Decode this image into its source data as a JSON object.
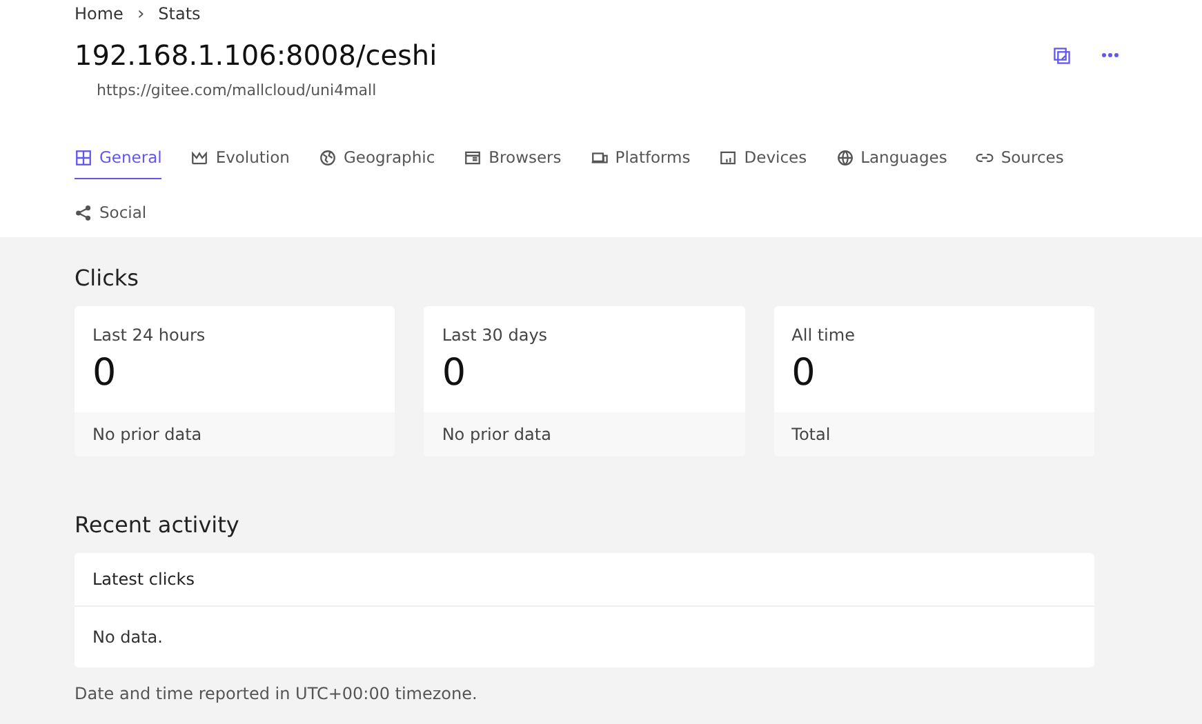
{
  "breadcrumb": [
    "Home",
    "Stats"
  ],
  "breadcrumb_separator": "›",
  "title": "192.168.1.106:8008/ceshi",
  "url": "https://gitee.com/mallcloud/uni4mall",
  "tabs": [
    {
      "label": "General",
      "selected": true
    },
    {
      "label": "Evolution",
      "selected": false
    },
    {
      "label": "Geographic",
      "selected": false
    },
    {
      "label": "Browsers",
      "selected": false
    },
    {
      "label": "Platforms",
      "selected": false
    },
    {
      "label": "Devices",
      "selected": false
    },
    {
      "label": "Languages",
      "selected": false
    },
    {
      "label": "Sources",
      "selected": false
    },
    {
      "label": "Social",
      "selected": false
    }
  ],
  "clicks": {
    "heading": "Clicks",
    "cards": [
      {
        "label": "Last 24 hours",
        "value": "0",
        "footer": "No prior data"
      },
      {
        "label": "Last 30 days",
        "value": "0",
        "footer": "No prior data"
      },
      {
        "label": "All time",
        "value": "0",
        "footer": "Total"
      }
    ]
  },
  "recent_activity": {
    "heading": "Recent activity",
    "panel_title": "Latest clicks",
    "empty_text": "No data."
  },
  "footnote": "Date and time reported in UTC+00:00 timezone."
}
